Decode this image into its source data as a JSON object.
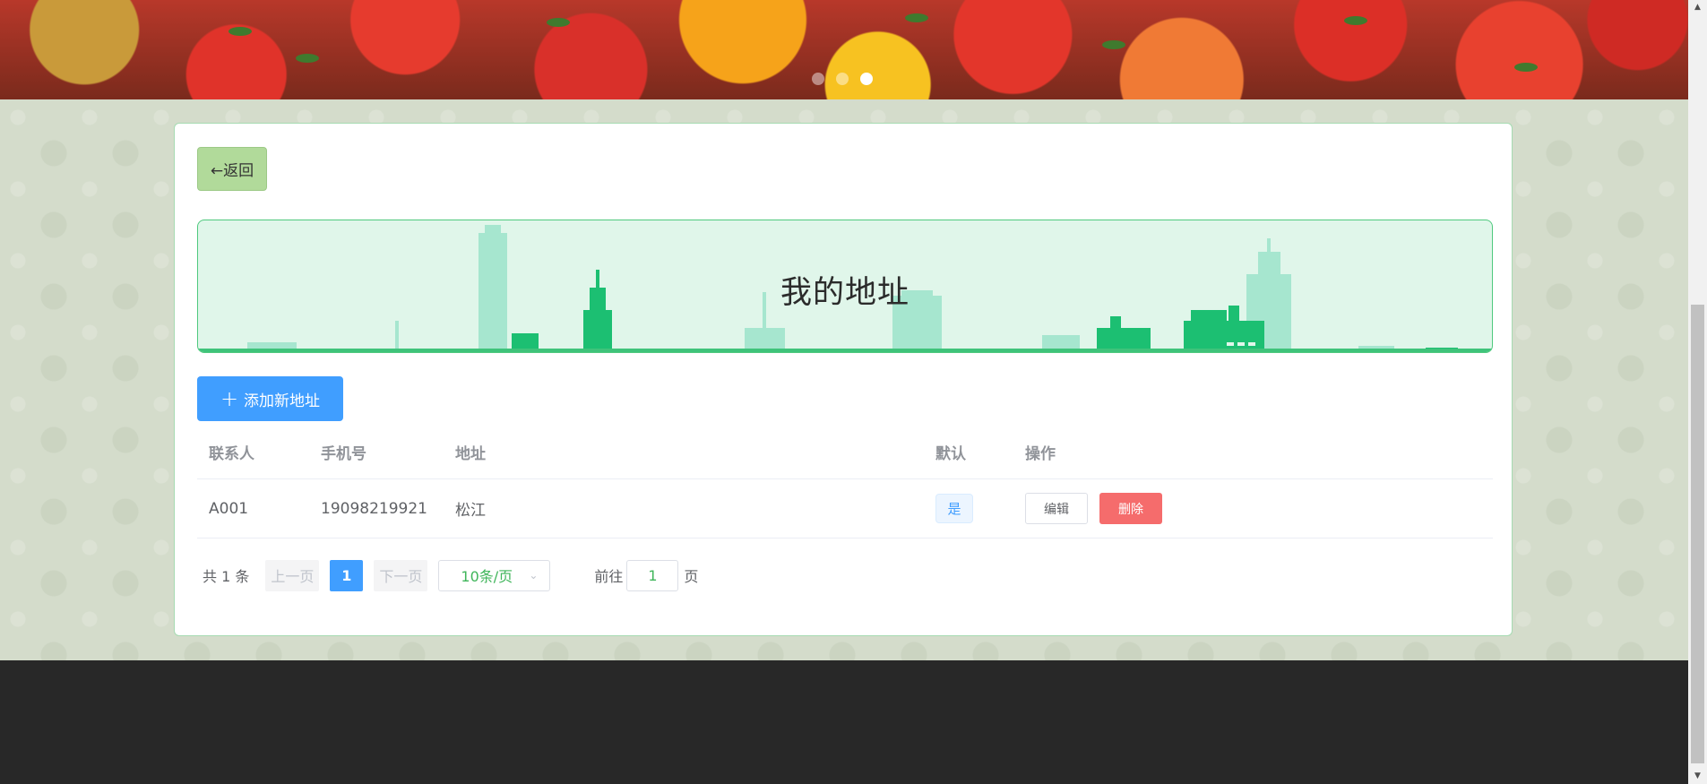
{
  "carousel": {
    "slide_count": 3,
    "active_index": 2
  },
  "back_button": {
    "label": "←返回"
  },
  "page_title": "我的地址",
  "add_button": {
    "icon": "plus-icon",
    "label": "添加新地址"
  },
  "table": {
    "columns": [
      "联系人",
      "手机号",
      "地址",
      "默认",
      "操作"
    ],
    "rows": [
      {
        "contact": "A001",
        "phone": "19098219921",
        "address": "松江",
        "default": "是",
        "edit_label": "编辑",
        "delete_label": "删除"
      }
    ]
  },
  "pagination": {
    "total_text": "共 1 条",
    "prev_label": "上一页",
    "current_page": "1",
    "next_label": "下一页",
    "page_size_label": "10条/页",
    "goto_label": "前往",
    "goto_value": "1",
    "page_suffix": "页"
  },
  "colors": {
    "primary": "#409eff",
    "danger": "#f56c6c",
    "back_button": "#b1da9a",
    "banner_bg": "#e0f6ea",
    "footer": "#282828"
  }
}
